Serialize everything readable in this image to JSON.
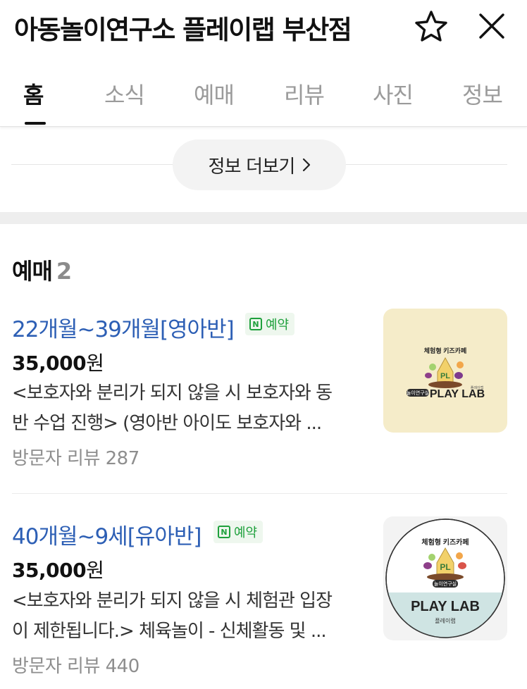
{
  "header": {
    "title": "아동놀이연구소 플레이랩 부산점",
    "star_icon": "star-outline-icon",
    "close_icon": "close-icon"
  },
  "tabs": [
    {
      "label": "홈",
      "active": true
    },
    {
      "label": "소식",
      "active": false
    },
    {
      "label": "예매",
      "active": false
    },
    {
      "label": "리뷰",
      "active": false
    },
    {
      "label": "사진",
      "active": false
    },
    {
      "label": "정보",
      "active": false
    }
  ],
  "more_info": {
    "label": "정보 더보기",
    "icon": "chevron-right-icon"
  },
  "section": {
    "title": "예매",
    "count": "2"
  },
  "items": [
    {
      "title": "22개월~39개월[영아반]",
      "badge": {
        "icon_letter": "N",
        "label": "예약"
      },
      "price": "35,000",
      "currency": "원",
      "desc_line1": "<보호자와 분리가 되지 않을 시 보호자와 동",
      "desc_line2": "반 수업 진행> (영아반 아이도 보호자와 ...",
      "reviews": "방문자 리뷰 287",
      "thumb": {
        "bg": "#f5ecc9",
        "logo_top": "체험형 키즈카페",
        "logo_main": "PLAY LAB",
        "logo_left": "놀이연구실",
        "logo_small": "플레이랩"
      }
    },
    {
      "title": "40개월~9세[유아반]",
      "badge": {
        "icon_letter": "N",
        "label": "예약"
      },
      "price": "35,000",
      "currency": "원",
      "desc_line1": "<보호자와 분리가 되지 않을 시 체험관 입장",
      "desc_line2": "이 제한됩니다.> 체육놀이 - 신체활동 및 ...",
      "reviews": "방문자 리뷰 440",
      "thumb": {
        "bg": "#f3f3f3",
        "logo_top": "체험형 키즈카페",
        "logo_main": "PLAY LAB",
        "logo_left": "놀이연구실",
        "logo_small": "플레이랩"
      }
    }
  ],
  "colors": {
    "link_blue": "#2d5fb5",
    "badge_green": "#1ea03c",
    "muted_gray": "#8e8e8e"
  }
}
